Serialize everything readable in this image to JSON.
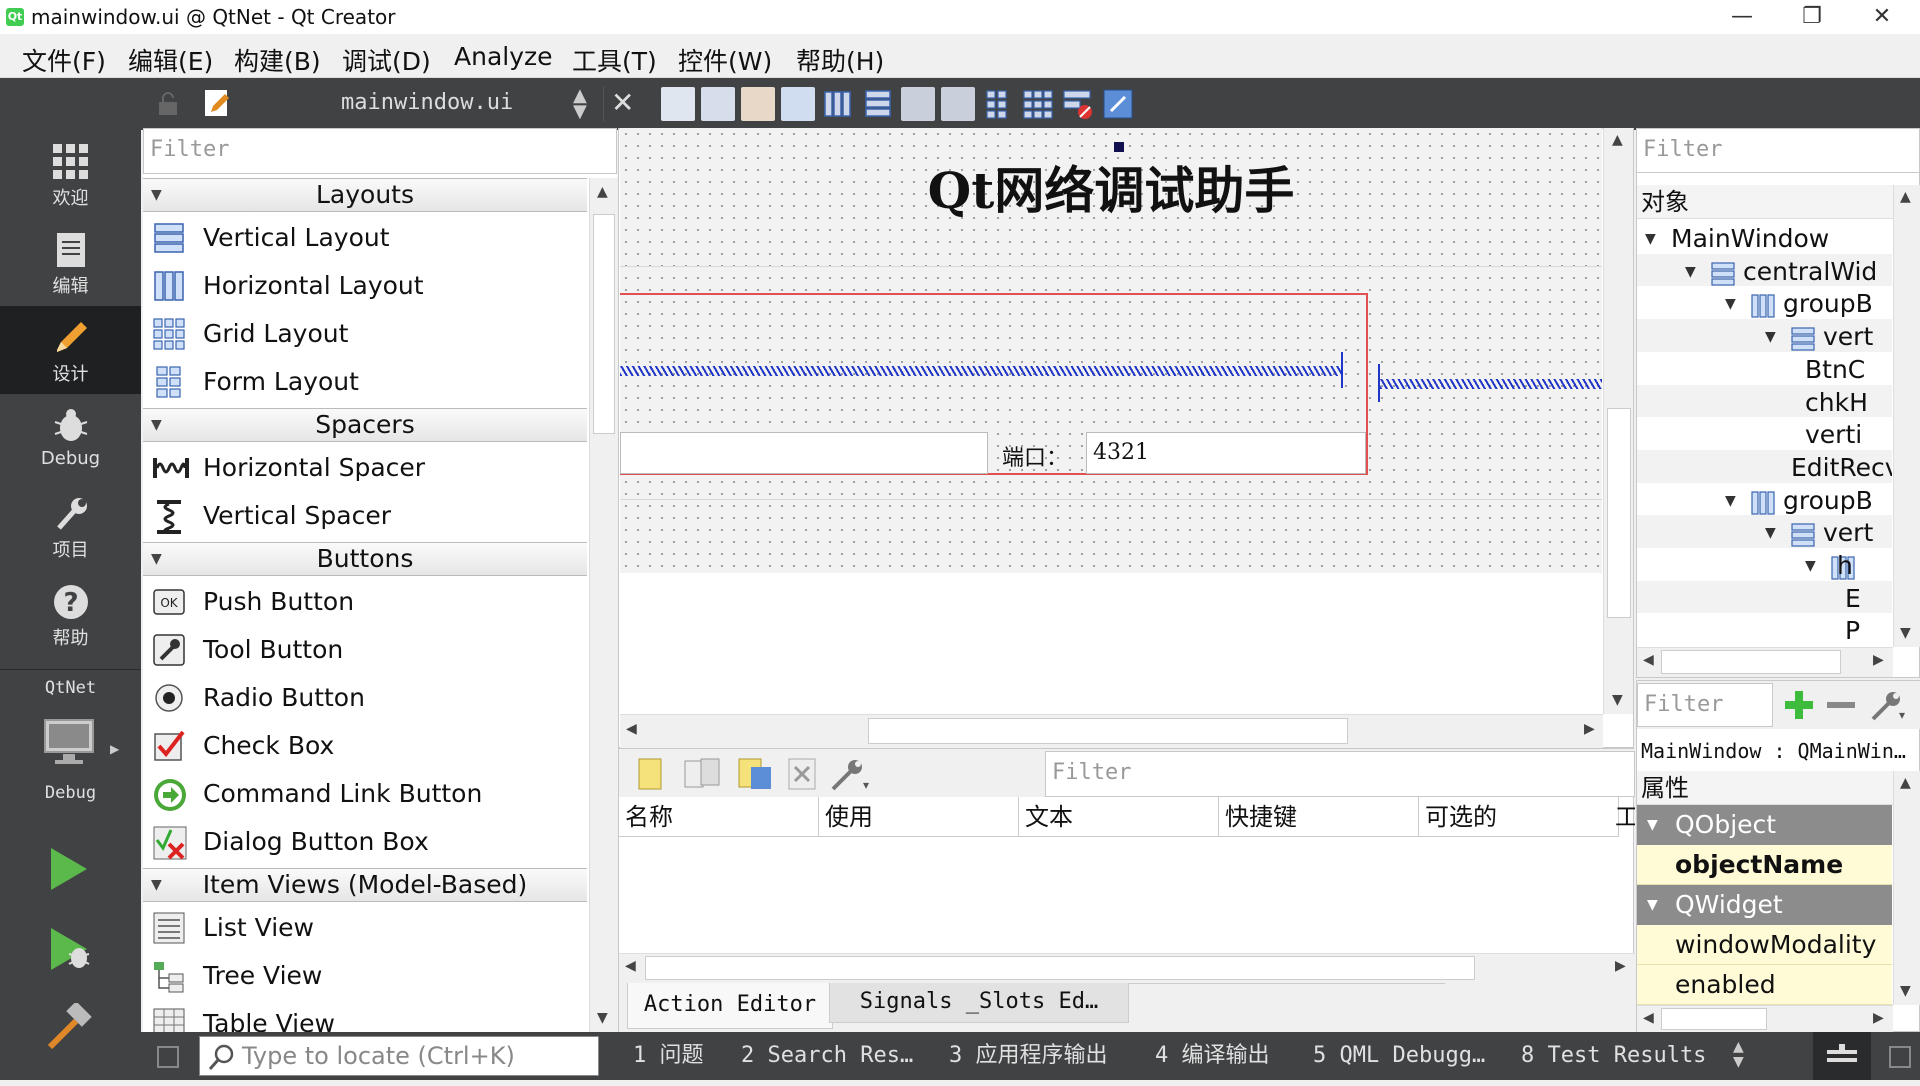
{
  "window": {
    "title": "mainwindow.ui @ QtNet - Qt Creator",
    "app_icon_text": "Qt",
    "minimize": "—",
    "restore": "❐",
    "close": "✕"
  },
  "menu": [
    "文件(F)",
    "编辑(E)",
    "构建(B)",
    "调试(D)",
    "Analyze",
    "工具(T)",
    "控件(W)",
    "帮助(H)"
  ],
  "modes": [
    {
      "label": "欢迎",
      "icon": "grid-icon"
    },
    {
      "label": "编辑",
      "icon": "document-icon"
    },
    {
      "label": "设计",
      "icon": "pencil-icon"
    },
    {
      "label": "Debug",
      "icon": "bug-icon"
    },
    {
      "label": "项目",
      "icon": "wrench-icon"
    },
    {
      "label": "帮助",
      "icon": "help-icon"
    }
  ],
  "kit": {
    "project": "QtNet",
    "config": "Debug"
  },
  "toolbar": {
    "file": "mainwindow.ui"
  },
  "widget_box": {
    "filter_placeholder": "Filter",
    "categories": {
      "layouts": "Layouts",
      "spacers": "Spacers",
      "buttons": "Buttons",
      "item_views": "Item Views (Model-Based)"
    },
    "items": {
      "vertical_layout": "Vertical Layout",
      "horizontal_layout": "Horizontal Layout",
      "grid_layout": "Grid Layout",
      "form_layout": "Form Layout",
      "horizontal_spacer": "Horizontal Spacer",
      "vertical_spacer": "Vertical Spacer",
      "push_button": "Push Button",
      "tool_button": "Tool Button",
      "radio_button": "Radio Button",
      "check_box": "Check Box",
      "command_link_button": "Command Link Button",
      "dialog_button_box": "Dialog Button Box",
      "list_view": "List View",
      "tree_view": "Tree View",
      "table_view": "Table View"
    }
  },
  "form": {
    "title": "Qt网络调试助手",
    "port_label": "端口：",
    "port_value": "4321"
  },
  "action_editor": {
    "filter_placeholder": "Filter",
    "columns": [
      "名称",
      "使用",
      "文本",
      "快捷键",
      "可选的",
      "工"
    ],
    "tabs": [
      "Action Editor",
      "Signals _Slots Ed…"
    ]
  },
  "object_inspector": {
    "filter_placeholder": "Filter",
    "header": "对象",
    "rows": [
      {
        "text": "MainWindow",
        "indent": 0,
        "arrow": true,
        "icon": false
      },
      {
        "text": "centralWid",
        "indent": 1,
        "arrow": true,
        "icon": "vlayout"
      },
      {
        "text": "groupB",
        "indent": 2,
        "arrow": true,
        "icon": "hlayout"
      },
      {
        "text": "vert",
        "indent": 3,
        "arrow": true,
        "icon": "vlayout"
      },
      {
        "text": "BtnC",
        "indent": 4,
        "arrow": false,
        "icon": false
      },
      {
        "text": "chkH",
        "indent": 4,
        "arrow": false,
        "icon": false
      },
      {
        "text": "verti",
        "indent": 4,
        "arrow": false,
        "icon": false
      },
      {
        "text": "EditRecv",
        "indent": 3,
        "arrow": false,
        "icon": false
      },
      {
        "text": "groupB",
        "indent": 2,
        "arrow": true,
        "icon": "hlayout"
      },
      {
        "text": "vert",
        "indent": 3,
        "arrow": true,
        "icon": "vlayout"
      },
      {
        "text": "h",
        "indent": 4,
        "arrow": true,
        "icon": "hlayout"
      },
      {
        "text": "E",
        "indent": 5,
        "arrow": false,
        "icon": false
      },
      {
        "text": "P",
        "indent": 5,
        "arrow": false,
        "icon": false
      }
    ]
  },
  "property_editor": {
    "filter_placeholder": "Filter",
    "object_line": "MainWindow : QMainWin…",
    "header": "属性",
    "rows": [
      {
        "text": "QObject",
        "kind": "category"
      },
      {
        "text": "objectName",
        "kind": "bold"
      },
      {
        "text": "QWidget",
        "kind": "category"
      },
      {
        "text": "windowModality",
        "kind": "normal"
      },
      {
        "text": "enabled",
        "kind": "normal"
      }
    ]
  },
  "bottom": {
    "locator_placeholder": "Type to locate (Ctrl+K)",
    "tabs": [
      "1  问题",
      "2  Search Res…",
      "3  应用程序输出",
      "4  编译输出",
      "5  QML Debugg…",
      "8  Test Results"
    ]
  },
  "colors": {
    "sidebar": "#404244",
    "active_mode": "#1f2022",
    "selection_red": "#e05050",
    "spacer_blue": "#2036c8",
    "property_yellow": "#fffbd6",
    "category_gray": "#8c8c8c"
  }
}
